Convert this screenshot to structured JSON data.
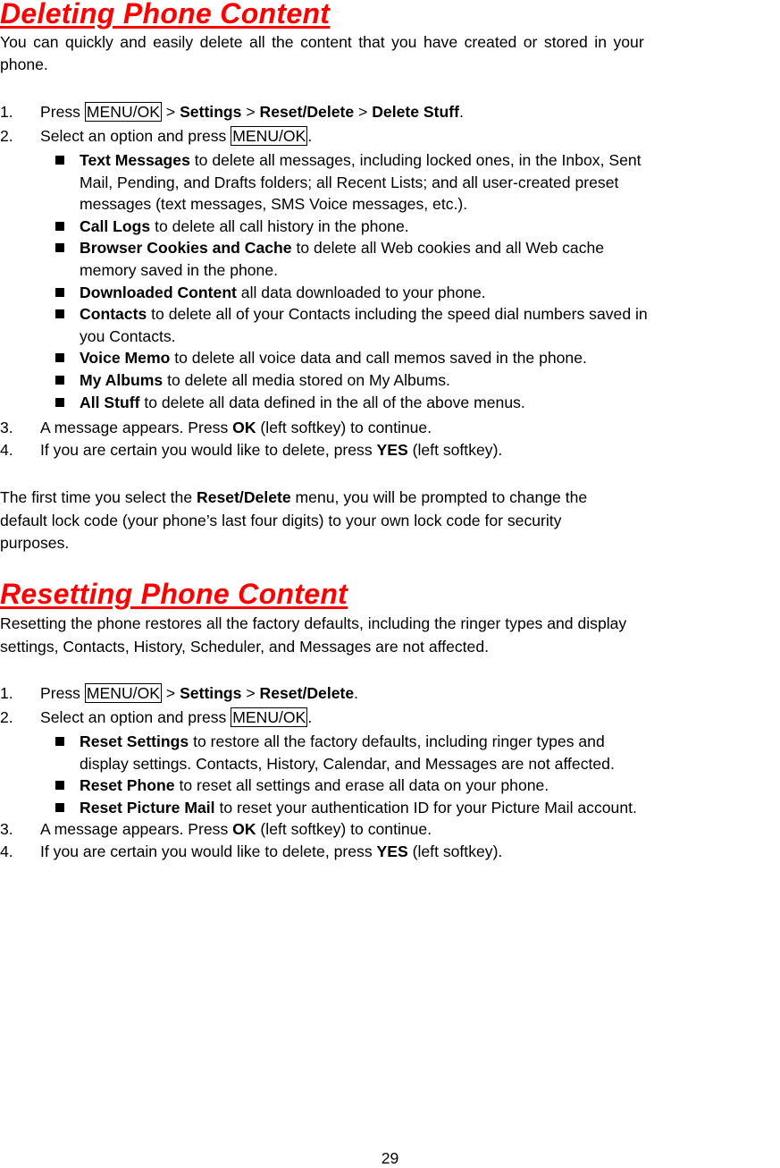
{
  "section1": {
    "title": "Deleting Phone Content",
    "intro": "You can quickly and easily delete all the content that you have created or stored in your phone.",
    "intro_line1": "You can quickly and easily delete all the content that you have created or stored in your",
    "intro_line2": "phone.",
    "steps": [
      {
        "num": "1.",
        "pre": "Press ",
        "key": "MENU/OK",
        "sep1": " > ",
        "b1": "Settings",
        "sep2": " > ",
        "b2": "Reset/Delete",
        "sep3": " > ",
        "b3": "Delete Stuff",
        "end": "."
      },
      {
        "num": "2.",
        "pre": "Select an option and press ",
        "key": "MENU/OK",
        "end": "."
      }
    ],
    "bullets": [
      {
        "bold": "Text Messages",
        "lines": [
          " to delete all messages, including locked ones, in the Inbox, Sent",
          "Mail, Pending, and Drafts folders; all Recent Lists; and all user-created preset",
          "messages (text messages, SMS Voice messages, etc.)."
        ]
      },
      {
        "bold": "Call Logs",
        "lines": [
          " to delete all call history in the phone."
        ]
      },
      {
        "bold": "Browser Cookies and Cache",
        "lines": [
          " to delete all Web cookies and all Web cache",
          "memory saved in the phone."
        ]
      },
      {
        "bold": "Downloaded Content",
        "lines": [
          " all data downloaded to your phone."
        ]
      },
      {
        "bold": "Contacts",
        "lines": [
          " to delete all of your Contacts including the speed dial numbers saved in",
          "you Contacts."
        ]
      },
      {
        "bold": "Voice Memo",
        "lines": [
          " to delete all voice data and call memos saved in the phone."
        ]
      },
      {
        "bold": "My Albums",
        "lines": [
          " to delete all media stored on My Albums."
        ]
      },
      {
        "bold": "All Stuff",
        "lines": [
          " to delete all data defined in the all of the above menus."
        ]
      }
    ],
    "step3": {
      "num": "3.",
      "pre": "A message appears. Press ",
      "bold": "OK",
      "post": " (left softkey) to continue."
    },
    "step4": {
      "num": "4.",
      "pre": "If you are certain you would like to delete, press ",
      "bold": "YES",
      "post": " (left softkey)."
    },
    "note": {
      "line1_pre": "The first time you select the ",
      "line1_bold": "Reset/Delete",
      "line1_post": " menu, you will be prompted to change the",
      "line2": "default lock code (your phone’s last four digits) to your own lock code for security",
      "line3": "purposes."
    }
  },
  "section2": {
    "title": "Resetting Phone Content",
    "intro_line1": "Resetting the phone restores all the factory defaults, including the ringer types and display",
    "intro_line2": "settings, Contacts, History, Scheduler, and Messages are not affected.",
    "steps": [
      {
        "num": "1.",
        "pre": "Press ",
        "key": "MENU/OK",
        "sep1": " > ",
        "b1": "Settings",
        "sep2": " > ",
        "b2": "Reset/Delete",
        "end": "."
      },
      {
        "num": "2.",
        "pre": "Select an option and press ",
        "key": "MENU/OK",
        "end": "."
      }
    ],
    "bullets": [
      {
        "bold": "Reset Settings",
        "lines": [
          " to restore all the factory defaults, including ringer types and",
          "display settings. Contacts, History, Calendar, and Messages are not affected."
        ]
      },
      {
        "bold": "Reset Phone",
        "lines": [
          " to reset all settings and erase all data on your phone."
        ]
      },
      {
        "bold": "Reset Picture Mail",
        "lines": [
          " to reset your authentication ID for your Picture Mail account."
        ]
      }
    ],
    "step3": {
      "num": "3.",
      "pre": "A message appears. Press ",
      "bold": "OK",
      "post": " (left softkey) to continue."
    },
    "step4": {
      "num": "4.",
      "pre": "If you are certain you would like to delete, press ",
      "bold": "YES",
      "post": " (left softkey)."
    }
  },
  "page_number": "29",
  "colors": {
    "heading": "#ff0000",
    "text": "#000000"
  }
}
